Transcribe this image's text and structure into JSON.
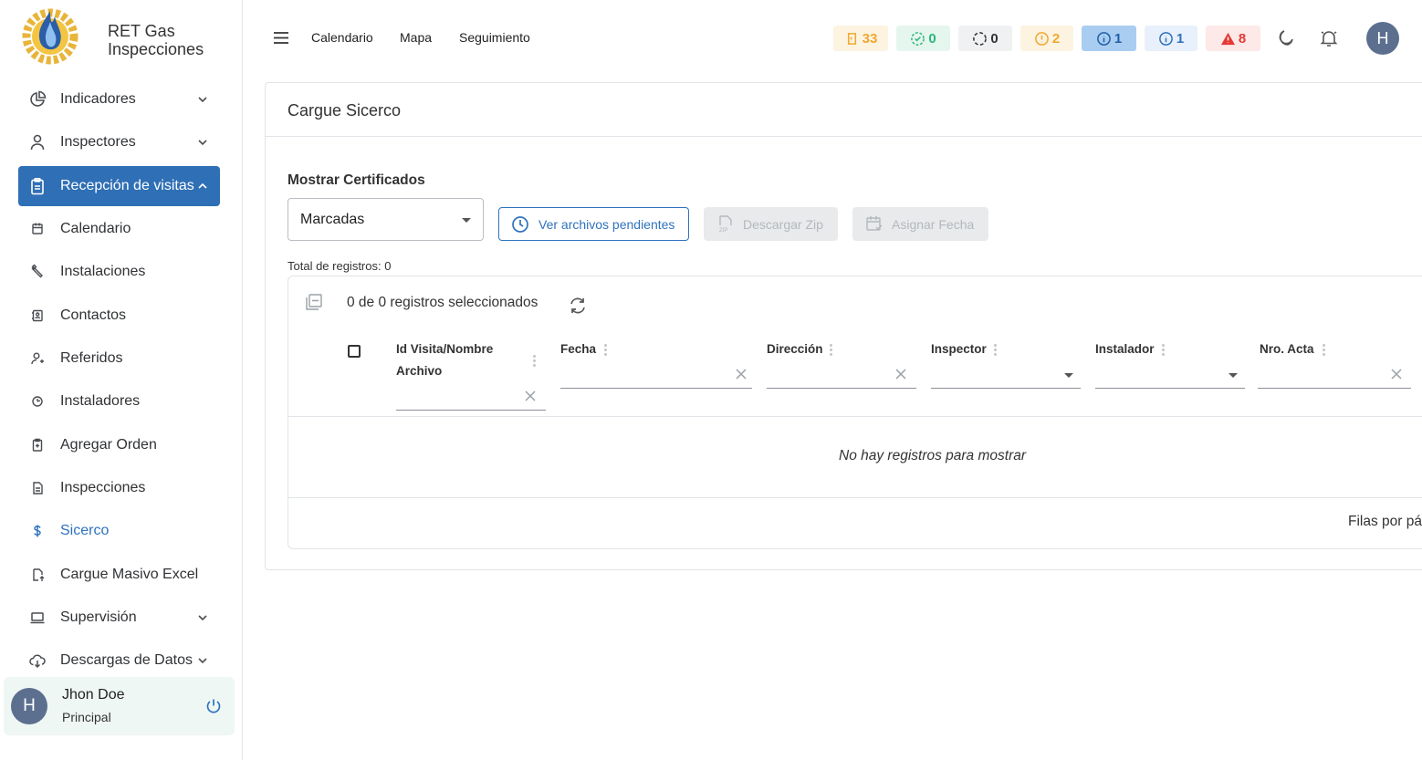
{
  "brand": {
    "line1": "RET Gas",
    "line2": "Inspecciones"
  },
  "sidebar": {
    "items": [
      {
        "label": "Indicadores",
        "icon": "pie-chart-icon",
        "expandable": true
      },
      {
        "label": "Inspectores",
        "icon": "person-icon",
        "expandable": true
      },
      {
        "label": "Recepción de visitas",
        "icon": "clipboard-icon",
        "expandable": true,
        "expanded": true
      },
      {
        "label": "Calendario",
        "icon": "calendar-icon"
      },
      {
        "label": "Instalaciones",
        "icon": "wrench-icon"
      },
      {
        "label": "Contactos",
        "icon": "contacts-icon"
      },
      {
        "label": "Referidos",
        "icon": "person-add-icon"
      },
      {
        "label": "Instaladores",
        "icon": "tool-icon"
      },
      {
        "label": "Agregar Orden",
        "icon": "clipboard-add-icon"
      },
      {
        "label": "Inspecciones",
        "icon": "document-icon"
      },
      {
        "label": "Sicerco",
        "icon": "dollar-icon"
      },
      {
        "label": "Cargue Masivo Excel",
        "icon": "excel-upload-icon"
      },
      {
        "label": "Supervisión",
        "icon": "laptop-icon",
        "expandable": true
      },
      {
        "label": "Descargas de Datos",
        "icon": "cloud-download-icon",
        "expandable": true
      }
    ],
    "user": {
      "initial": "H",
      "name": "Jhon Doe",
      "role": "Principal"
    }
  },
  "topbar": {
    "links": [
      "Calendario",
      "Mapa",
      "Seguimiento"
    ],
    "badges": [
      {
        "value": "33",
        "icon": "clipboard-alert-icon",
        "color": "#f0a830",
        "bg": "#fdf3e1"
      },
      {
        "value": "0",
        "icon": "check-circle-dashed-icon",
        "color": "#2eb67d",
        "bg": "#e5f6ee"
      },
      {
        "value": "0",
        "icon": "loading-circle-icon",
        "color": "#333333",
        "bg": "#f0f1f3"
      },
      {
        "value": "2",
        "icon": "alert-circle-icon",
        "color": "#f0a830",
        "bg": "#fdf3e1"
      },
      {
        "value": "1",
        "icon": "info-circle-icon",
        "color": "#1f5fa8",
        "bg": "#a9cdf0"
      },
      {
        "value": "1",
        "icon": "info-circle-icon",
        "color": "#2f72bd",
        "bg": "#e7f0fb"
      },
      {
        "value": "8",
        "icon": "warning-triangle-icon",
        "color": "#e53935",
        "bg": "#fde9e8"
      }
    ],
    "avatar_initial": "H"
  },
  "main": {
    "title": "Cargue Sicerco",
    "section_title": "Mostrar Certificados",
    "filter_select": {
      "value": "Marcadas"
    },
    "buttons": {
      "pending": "Ver archivos pendientes",
      "zip": "Descargar Zip",
      "assign": "Asignar Fecha"
    },
    "total": "Total de registros: 0",
    "table": {
      "selection_text": "0 de 0 registros seleccionados",
      "columns": [
        {
          "line1": "Id Visita/Nombre",
          "line2": "Archivo",
          "filter": "text"
        },
        {
          "line1": "Fecha",
          "filter": "text"
        },
        {
          "line1": "Dirección",
          "filter": "text"
        },
        {
          "line1": "Inspector",
          "filter": "select"
        },
        {
          "line1": "Instalador",
          "filter": "select"
        },
        {
          "line1": "Nro. Acta",
          "filter": "text"
        }
      ],
      "empty_message": "No hay registros para mostrar",
      "rows_per_page_label": "Filas por pá"
    }
  },
  "colors": {
    "primary": "#2f6fb5",
    "link_active": "#2f72bd"
  }
}
